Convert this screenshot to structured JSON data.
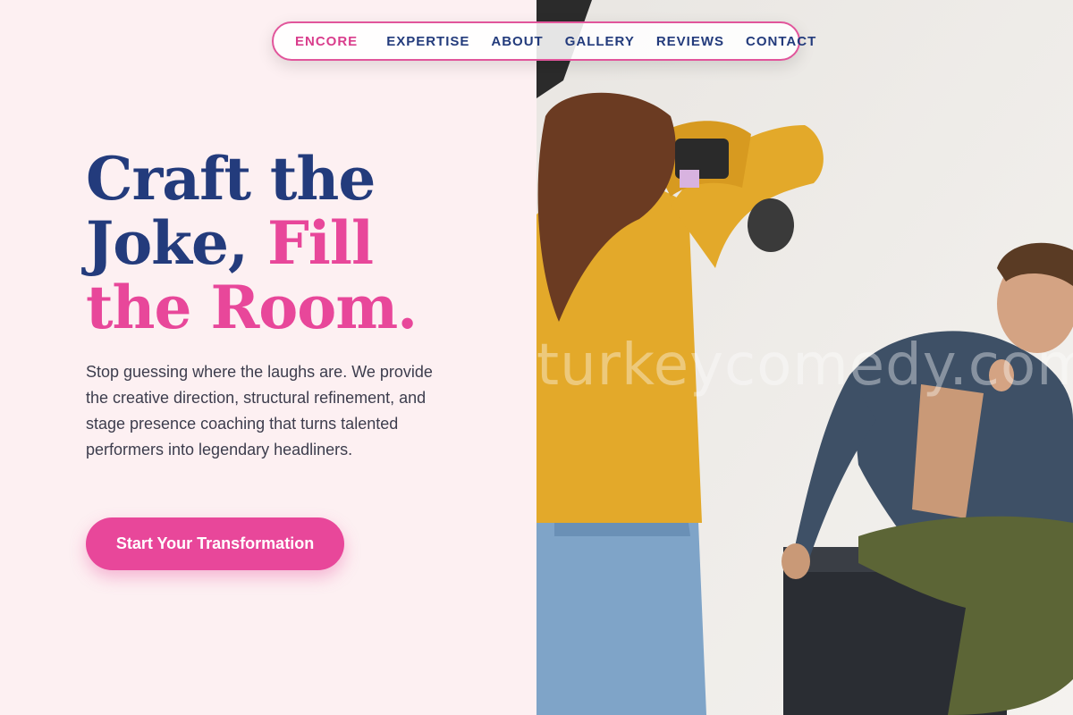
{
  "nav": {
    "brand": "ENCORE",
    "links": [
      "EXPERTISE",
      "ABOUT",
      "GALLERY",
      "REVIEWS",
      "CONTACT"
    ]
  },
  "hero": {
    "headline_line1": "Craft the",
    "headline_line2_dark": "Joke, ",
    "headline_line2_pink": "Fill",
    "headline_line3": "the Room.",
    "description": "Stop guessing where the laughs are. We provide the creative direction, structural refinement, and stage presence coaching that turns talented performers into legendary headliners.",
    "cta_label": "Start Your Transformation"
  },
  "image": {
    "watermark": "turkeycomedy.com"
  },
  "colors": {
    "navy": "#233b7c",
    "pink": "#e8479a",
    "background": "#fdf0f2"
  }
}
